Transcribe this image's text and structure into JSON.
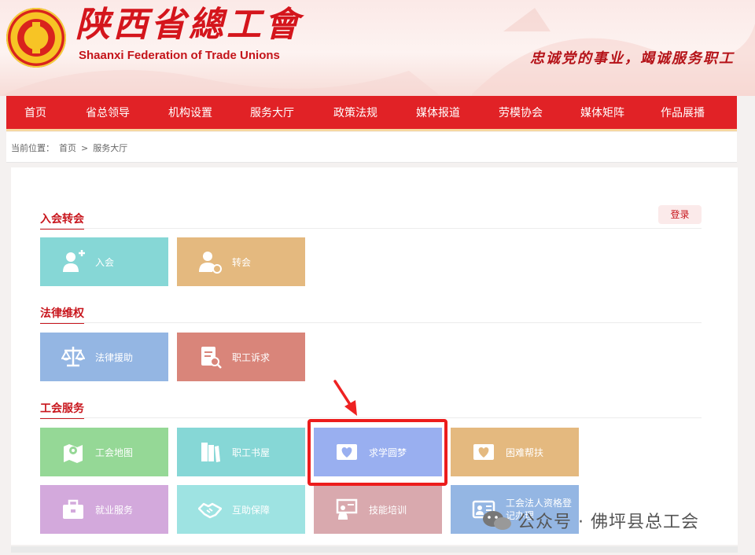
{
  "header": {
    "title": "陕西省總工會",
    "subtitle": "Shaanxi Federation of Trade Unions",
    "slogan": "忠诚党的事业，竭诚服务职工"
  },
  "nav": [
    "首页",
    "省总领导",
    "机构设置",
    "服务大厅",
    "政策法规",
    "媒体报道",
    "劳模协会",
    "媒体矩阵",
    "作品展播"
  ],
  "breadcrumb": {
    "label": "当前位置：",
    "home": "首页",
    "sep": ">",
    "current": "服务大厅"
  },
  "login": "登录",
  "sections": [
    {
      "title": "入会转会",
      "tiles": [
        {
          "label": "入会",
          "icon": "add-user-icon",
          "color": "#86d7d6"
        },
        {
          "label": "转会",
          "icon": "transfer-user-icon",
          "color": "#e4b97f"
        }
      ]
    },
    {
      "title": "法律维权",
      "tiles": [
        {
          "label": "法律援助",
          "icon": "scale-icon",
          "color": "#94b6e3"
        },
        {
          "label": "职工诉求",
          "icon": "document-search-icon",
          "color": "#d9857a"
        }
      ]
    },
    {
      "title": "工会服务",
      "tiles": [
        {
          "label": "工会地图",
          "icon": "map-pin-icon",
          "color": "#95d896"
        },
        {
          "label": "职工书屋",
          "icon": "book-icon",
          "color": "#86d7d6"
        },
        {
          "label": "求学圆梦",
          "icon": "heart-book-icon",
          "color": "#99aff0"
        },
        {
          "label": "困难帮扶",
          "icon": "heart-card-icon",
          "color": "#e4b97f"
        },
        {
          "label": "就业服务",
          "icon": "briefcase-icon",
          "color": "#d3a9dc"
        },
        {
          "label": "互助保障",
          "icon": "handshake-icon",
          "color": "#9ee3e2"
        },
        {
          "label": "技能培训",
          "icon": "training-icon",
          "color": "#d9a9ae"
        },
        {
          "label": "工会法人资格登记办理",
          "icon": "id-card-icon",
          "color": "#94b6e3"
        }
      ]
    }
  ],
  "watermark": "公众号 · 佛坪县总工会"
}
